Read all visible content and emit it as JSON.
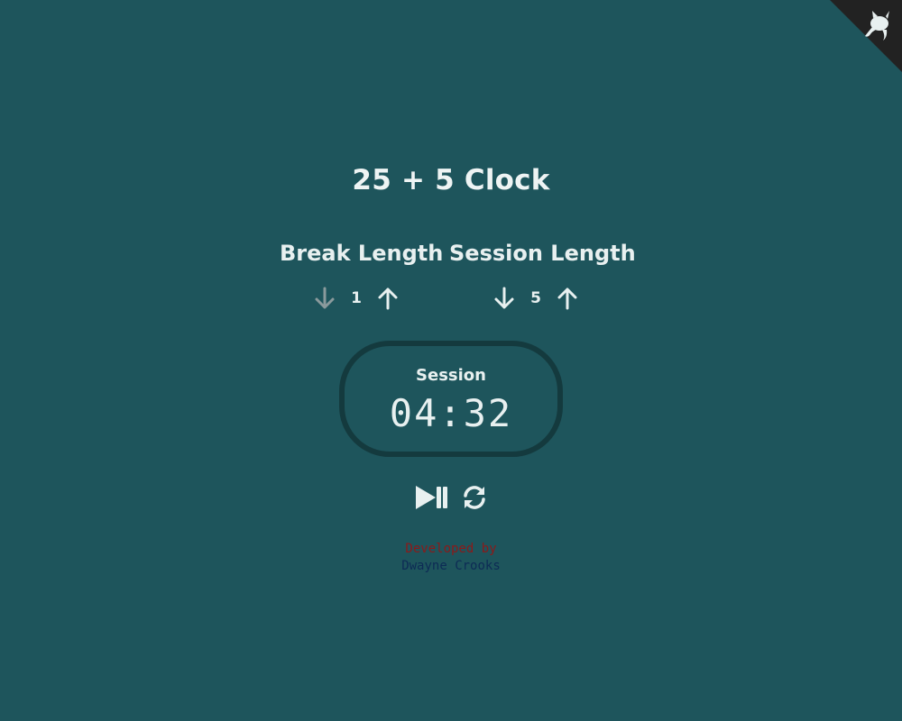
{
  "app": {
    "title": "25 + 5 Clock"
  },
  "break": {
    "label": "Break Length",
    "value": "1"
  },
  "session": {
    "label": "Session Length",
    "value": "5"
  },
  "timer": {
    "label": "Session",
    "time": "04:32"
  },
  "footer": {
    "developed_by": "Developed by",
    "author": "Dwayne Crooks"
  },
  "icons": {
    "github_corner": "github-octocat-icon",
    "decrement": "arrow-down-icon",
    "increment": "arrow-up-icon",
    "start_stop": "play-pause-icon",
    "reset": "refresh-icon"
  },
  "colors": {
    "background": "#1e555c",
    "text": "#e8f0f0",
    "timer_border": "#143a3e",
    "disabled_arrow": "#8a9a9c",
    "corner": "#222222",
    "developed_by": "#8b1a1a",
    "author": "#0d2b55"
  }
}
